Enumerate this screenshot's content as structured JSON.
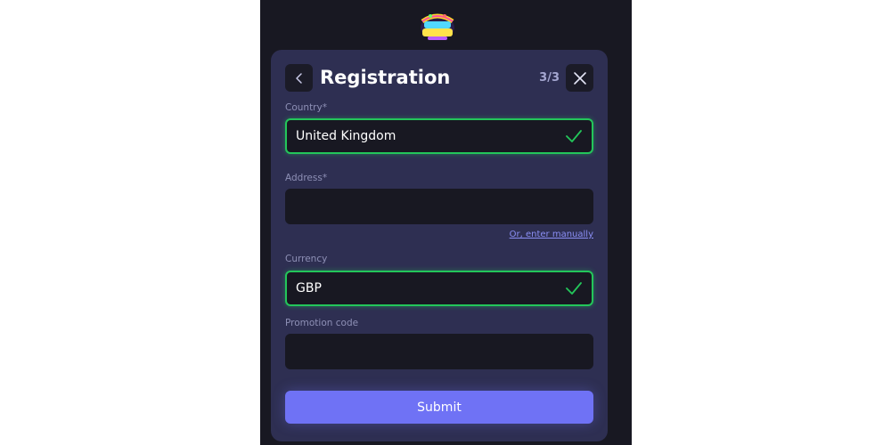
{
  "header": {
    "title": "Registration",
    "step": "3/3"
  },
  "form": {
    "country": {
      "label": "Country*",
      "value": "United Kingdom"
    },
    "address": {
      "label": "Address*",
      "value": "",
      "manual_link": "Or, enter manually"
    },
    "currency": {
      "label": "Currency",
      "value": "GBP"
    },
    "promo": {
      "label": "Promotion code",
      "value": ""
    },
    "submit_label": "Submit"
  },
  "icons": {
    "logo": "funky-jackpot-logo",
    "back": "chevron-left-icon",
    "close": "close-icon",
    "check": "check-icon"
  },
  "colors": {
    "accent": "#6f72f5",
    "valid": "#23c65a",
    "modal_bg": "#2e2f52",
    "page_bg": "#181822"
  }
}
